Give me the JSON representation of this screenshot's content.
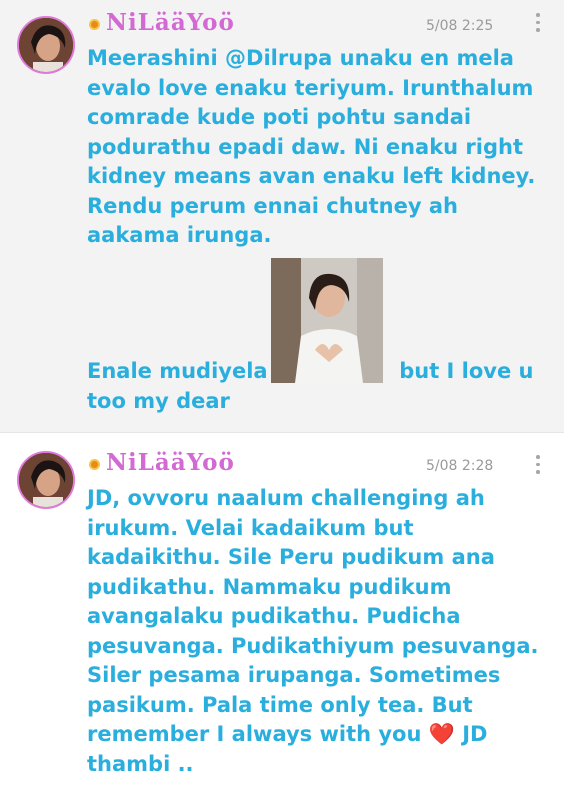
{
  "posts": [
    {
      "username": "NiLääYoö",
      "time": "5/08 2:25",
      "text_part1": "Meerashini @Dilrupa unaku en mela evalo love enaku teriyum. Irunthalum comrade kude poti pohtu sandai podurathu epadi daw. Ni enaku right kidney means avan enaku left kidney. Rendu perum ennai chutney ah aakama irunga.",
      "text_part2_before": "Enale mudiyela",
      "text_part2_after": "but I love u too my dear"
    },
    {
      "username": "NiLääYoö",
      "time": "5/08 2:28",
      "text_before_emoji": "JD, ovvoru naalum challenging ah irukum. Velai kadaikum but kadaikithu. Sile Peru pudikum ana pudikathu. Nammaku pudikum avangalaku pudikathu. Pudicha pesuvanga. Pudikathiyum pesuvanga. Siler pesama irupanga. Sometimes pasikum. Pala time only tea. But remember I always with you",
      "emoji": "❤️",
      "text_after_emoji": "JD thambi .."
    }
  ],
  "colors": {
    "username": "#d36ad4",
    "text": "#29aedd",
    "badge": "#e8891b"
  }
}
